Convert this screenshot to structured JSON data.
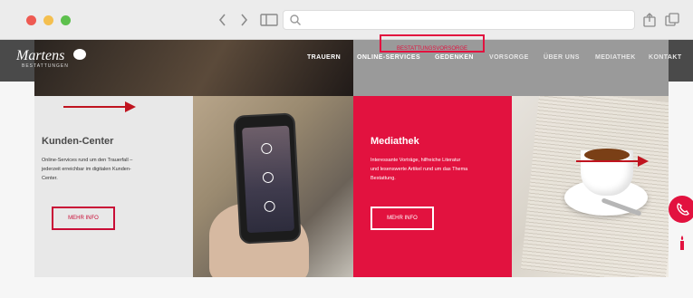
{
  "browser": {
    "back_icon": "chevron-left-icon",
    "forward_icon": "chevron-right-icon",
    "sidebar_icon": "sidebar-icon",
    "search_icon": "search-icon",
    "share_icon": "share-icon",
    "tabs_icon": "tabs-icon"
  },
  "header": {
    "logo_text": "Martens",
    "logo_sub": "BESTATTUNGEN",
    "cta_top": "BESTATTUNGSVORSORGE",
    "nav": [
      "TRAUERN",
      "ONLINE-SERVICES",
      "GEDENKEN",
      "VORSORGE",
      "ÜBER UNS",
      "MEDIATHEK",
      "KONTAKT"
    ]
  },
  "tiles": {
    "kunden": {
      "title": "Kunden-Center",
      "text_line1": "Online-Services rund um den Trauerfall –",
      "text_line2": "jederzeit erreichbar im digitalen Kunden-",
      "text_line3": "Center.",
      "button": "MEHR INFO"
    },
    "mediathek": {
      "title": "Mediathek",
      "text_line1": "Interessante Vorträge, hilfreiche Literatur",
      "text_line2": "und lesenswerte Artikel rund um das Thema",
      "text_line3": "Bestattung.",
      "button": "MEHR INFO"
    }
  },
  "colors": {
    "accent": "#e2123f",
    "arrow": "#c0141f"
  }
}
